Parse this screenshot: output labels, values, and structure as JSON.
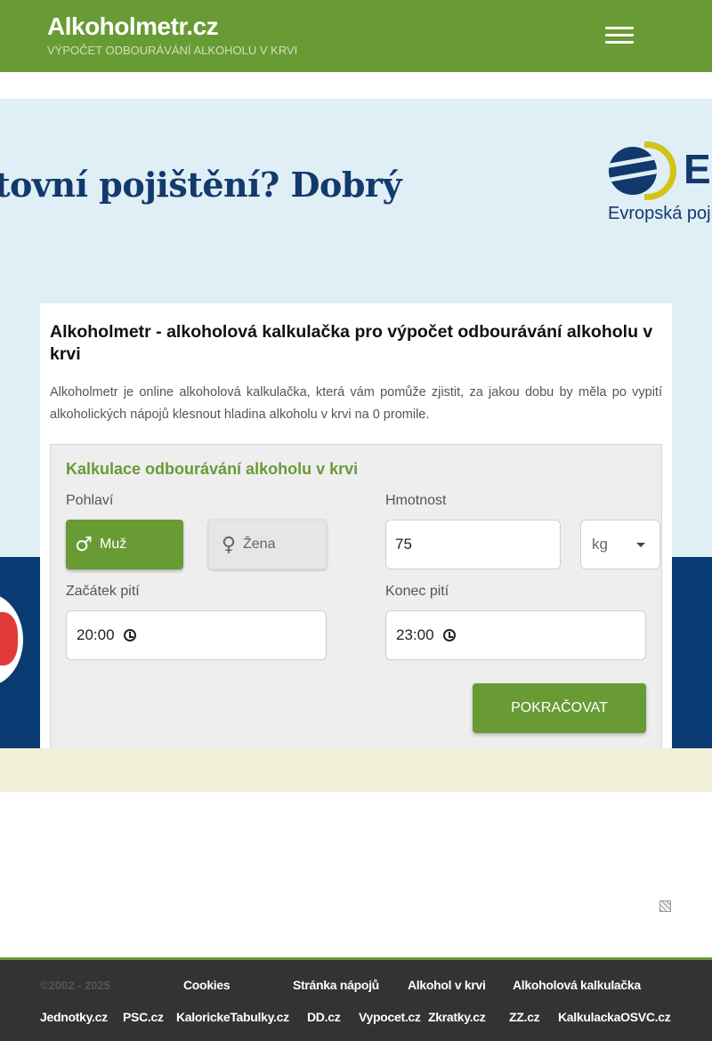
{
  "header": {
    "title": "Alkoholmetr.cz",
    "subtitle": "VÝPOČET ODBOURÁVÁNÍ ALKOHOLU V KRVI",
    "menu_icon": "hamburger-icon"
  },
  "ad": {
    "slogan": "tovní pojištění? Dobrý",
    "logo_letter": "E",
    "logo_text": "Evropská poji"
  },
  "card": {
    "title": "Alkoholmetr - alkoholová kalkulačka pro výpočet odbourávání alkoholu v krvi",
    "description": "Alkoholmetr je online alkoholová kalkulačka, která vám pomůže zjistit, za jakou dobu by měla po vypití alkoholických nápojů klesnout hladina alkoholu v krvi na 0 promile."
  },
  "calculator": {
    "title": "Kalkulace odbourávání alkoholu v krvi",
    "gender_label": "Pohlaví",
    "gender_male": "Muž",
    "gender_female": "Žena",
    "gender_selected": "Muž",
    "weight_label": "Hmotnost",
    "weight_value": "75",
    "weight_unit": "kg",
    "start_label": "Začátek pití",
    "start_value": "20:00",
    "end_label": "Konec pití",
    "end_value": "23:00",
    "continue_button": "POKRAČOVAT"
  },
  "footer": {
    "copyright": "©2002 - 2025",
    "links_row1": [
      "Cookies",
      "Stránka nápojů",
      "Alkohol v krvi",
      "Alkoholová kalkulačka"
    ],
    "links_row2": [
      "Jednotky.cz",
      "PSC.cz",
      "KalorickeTabulky.cz",
      "DD.cz",
      "Vypocet.cz",
      "Zkratky.cz",
      "ZZ.cz",
      "KalkulackaOSVC.cz"
    ]
  },
  "colors": {
    "brand_green": "#689b34",
    "ad_navy": "#12396b",
    "footer_bg": "#333333"
  }
}
